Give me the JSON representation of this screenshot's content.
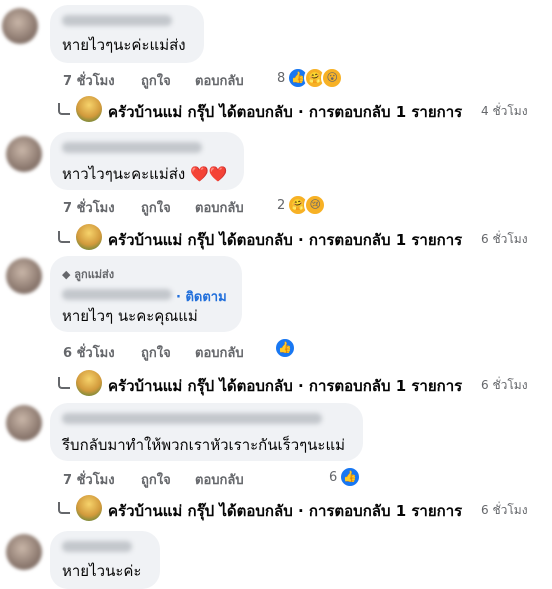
{
  "actions": {
    "time7": "7 ชั่วโมง",
    "time6": "6 ชั่วโมง",
    "like": "ถูกใจ",
    "reply": "ตอบกลับ"
  },
  "comments": [
    {
      "text": "หายไวๆนะค่ะแม่ส่ง",
      "reaction_count": "8"
    },
    {
      "text": "หาวไวๆนะคะแม่ส่ง ❤️❤️",
      "reaction_count": "2"
    },
    {
      "badge": "◆ ลูกแม่ส่ง",
      "follow": "· ติดตาม",
      "text": "หายไวๆ นะคะคุณแม่"
    },
    {
      "text": "รีบกลับมาทำให้พวกเราหัวเราะกันเร็วๆนะแม่",
      "reaction_count": "6"
    },
    {
      "text": "หายไวนะค่ะ"
    }
  ],
  "reply_summaries": [
    {
      "text": "ครัวบ้านแม่ กรุ๊ป ได้ตอบกลับ · การตอบกลับ 1 รายการ",
      "time": "4 ชั่วโมง"
    },
    {
      "text": "ครัวบ้านแม่ กรุ๊ป ได้ตอบกลับ · การตอบกลับ 1 รายการ",
      "time": "6 ชั่วโมง"
    },
    {
      "text": "ครัวบ้านแม่ กรุ๊ป ได้ตอบกลับ · การตอบกลับ 1 รายการ",
      "time": "6 ชั่วโมง"
    },
    {
      "text": "ครัวบ้านแม่ กรุ๊ป ได้ตอบกลับ · การตอบกลับ 1 รายการ",
      "time": "6 ชั่วโมง"
    }
  ]
}
